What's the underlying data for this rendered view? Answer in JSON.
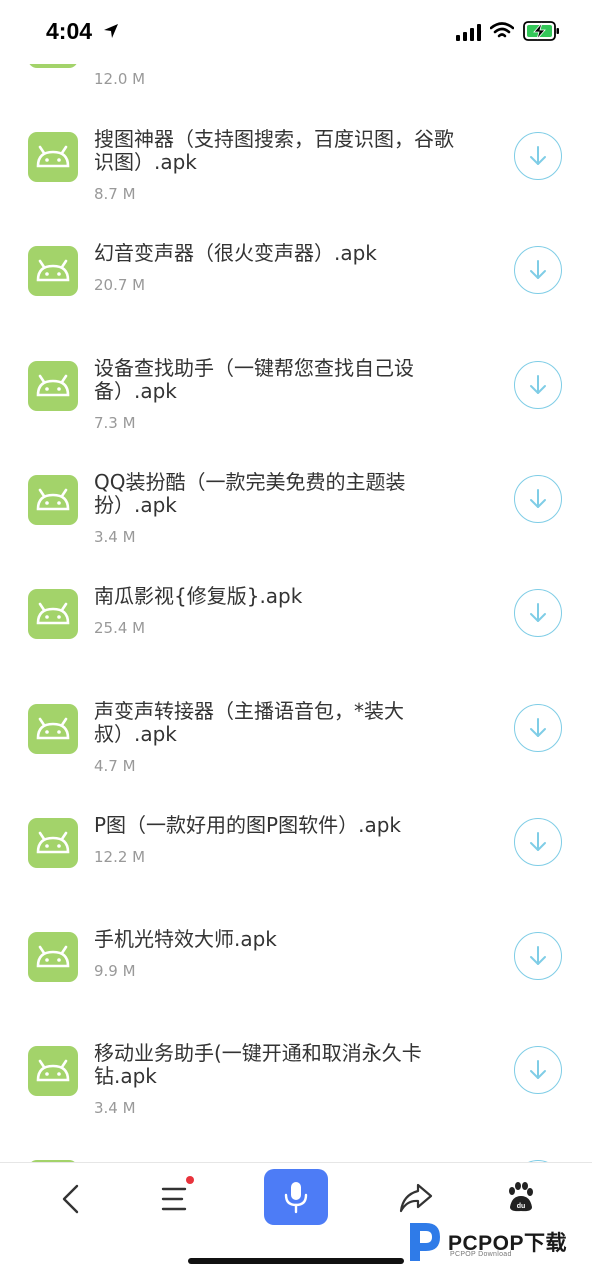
{
  "status_bar": {
    "time": "4:04"
  },
  "items": [
    {
      "name": "",
      "size": "12.0 M"
    },
    {
      "name": "搜图神器（支持图搜索，百度识图，谷歌识图）.apk",
      "size": "8.7 M"
    },
    {
      "name": "幻音变声器（很火变声器）.apk",
      "size": "20.7 M"
    },
    {
      "name": "设备查找助手（一键帮您查找自己设备）.apk",
      "size": "7.3 M"
    },
    {
      "name": "QQ装扮酷（一款完美免费的主题装扮）.apk",
      "size": "3.4 M"
    },
    {
      "name": "南瓜影视{修复版}.apk",
      "size": "25.4 M"
    },
    {
      "name": "声变声转接器（主播语音包，*装大叔）.apk",
      "size": "4.7 M"
    },
    {
      "name": "P图（一款好用的图P图软件）.apk",
      "size": "12.2 M"
    },
    {
      "name": "手机光特效大师.apk",
      "size": "9.9 M"
    },
    {
      "name": "移动业务助手(一键开通和取消永久卡钻.apk",
      "size": "3.4 M"
    },
    {
      "name": "",
      "size": ""
    }
  ],
  "bottom_nav": {
    "icons": [
      "back-icon",
      "menu-icon",
      "microphone-icon",
      "share-icon",
      "baidu-paw-icon"
    ]
  },
  "watermark": {
    "brand": "PCPOP下载",
    "sub": "PCPOP Download"
  },
  "colors": {
    "app_icon": "#a3d36a",
    "download_ring": "#7fcde6",
    "mic_button": "#4d7cf6",
    "notification_dot": "#e8333c"
  }
}
